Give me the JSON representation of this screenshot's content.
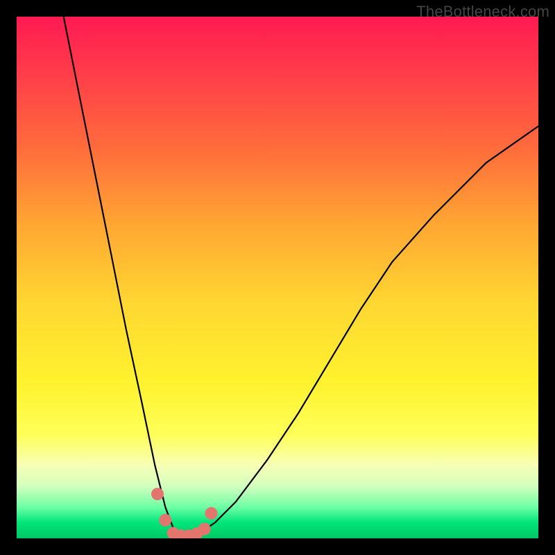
{
  "watermark": "TheBottleneck.com",
  "chart_data": {
    "type": "line",
    "title": "",
    "xlabel": "",
    "ylabel": "",
    "xlim": [
      0,
      100
    ],
    "ylim": [
      0,
      100
    ],
    "grid": false,
    "series": [
      {
        "name": "curve",
        "x": [
          9,
          12,
          15,
          18,
          21,
          24,
          26.5,
          28.5,
          30,
          31,
          32,
          33,
          35,
          38,
          42,
          48,
          54,
          60,
          66,
          72,
          80,
          90,
          100
        ],
        "y": [
          100,
          85,
          70,
          55,
          40,
          26,
          14,
          6,
          2,
          0.5,
          0.5,
          0.5,
          1,
          3,
          7,
          15,
          24,
          34,
          44,
          53,
          62,
          72,
          79
        ]
      },
      {
        "name": "markers",
        "x": [
          27,
          28.5,
          30,
          31.5,
          33,
          34.5,
          36,
          37.3
        ],
        "y": [
          8.5,
          3.5,
          1,
          0.5,
          0.5,
          0.9,
          1.8,
          4.8
        ]
      }
    ],
    "gradient_stops": [
      {
        "pos": 0,
        "color": "#ff1a53"
      },
      {
        "pos": 25,
        "color": "#ff6b3c"
      },
      {
        "pos": 55,
        "color": "#ffd732"
      },
      {
        "pos": 80,
        "color": "#ffff58"
      },
      {
        "pos": 97,
        "color": "#00e57a"
      }
    ]
  }
}
